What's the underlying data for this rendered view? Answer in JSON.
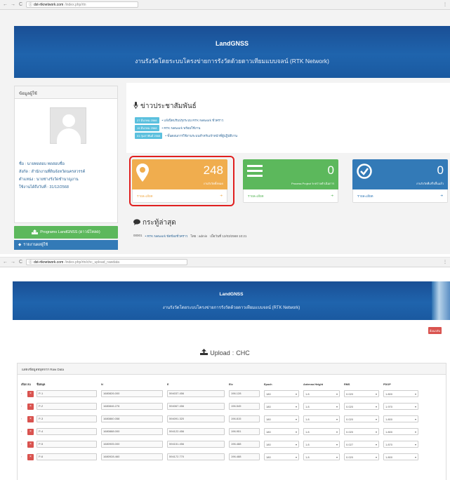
{
  "screen1": {
    "browser": {
      "back": "←",
      "forward": "→",
      "reload": "C",
      "info": "ⓘ",
      "host": "dst-rtknetwork.com",
      "path": "/index.php/rtn",
      "menu": "⋮"
    },
    "banner": {
      "brand": "LandGNSS",
      "subtitle": "งานรังวัดโดยระบบโครงข่ายการรังวัดด้วยดาวเทียมแบบจลน์ (RTK Network)"
    },
    "profile": {
      "header": "ข้อมูลผู้ใช้",
      "info": [
        "ชื่อ : นายทดสอบ ทดสอบชื่อ",
        "สังกัด : สำนักงานที่ดินจังหวัดนครสวรรค์",
        "ตำแหน่ง : นายช่างรังวัดชำนาญงาน",
        "ใช้งานได้ถึงวันที่ : 31/12/2568"
      ]
    },
    "program_button": "Programs LandGNSS (ดาวน์โหลด)",
    "menu_item": "รายงานผลผู้ใช้",
    "news": {
      "title": "ข่าวประชาสัมพันธ์",
      "items": [
        {
          "date": "27 มีนาคม 2568",
          "text": "• แจ้งปิดปรับปรุงระบบ RTK Network ชั่วคราว"
        },
        {
          "date": "15 มีนาคม 2568",
          "text": "• RTK Network พร้อมใช้งาน"
        },
        {
          "date": "01 กุมภาพันธ์ 2568",
          "text": "• ขั้นตอนการใช้งานระบบสำหรับเจ้าหน้าที่ผู้ปฏิบัติงาน"
        }
      ]
    },
    "cards": [
      {
        "value": "248",
        "caption": "งานรังวัดทั้งหมด",
        "footer": "รายละเอียด",
        "arrow": "➜"
      },
      {
        "value": "0",
        "caption": "Process Project ระหว่างดำเนินการ",
        "footer": "รายละเอียด",
        "arrow": "➜"
      },
      {
        "value": "0",
        "caption": "งานรังวัดที่เสร็จสิ้นแล้ว",
        "footer": "รายละเอียด",
        "arrow": "➜"
      }
    ],
    "announce": {
      "title": "กระทู้ล่าสุด",
      "id": "00001",
      "link": "• RTK Network ขัดข้องชั่วคราว",
      "by": "โดย : admin",
      "date": "เมื่อวันที่ 12/03/2568 10:21"
    }
  },
  "screen2": {
    "browser": {
      "back": "←",
      "forward": "→",
      "reload": "C",
      "info": "ⓘ",
      "host": "dst-rtknetwork.com",
      "path": "/index.php/rtn/chc_upload_rawdata",
      "menu": "⋮"
    },
    "banner": {
      "brand": "LandGNSS",
      "subtitle": "งานรังวัดโดยระบบโครงข่ายการรังวัดด้วยดาวเทียมแบบจลน์ (RTK Network)"
    },
    "back_button": "ย้อนกลับ",
    "upload_title": "Upload",
    "upload_vendor": "CHC",
    "panel_heading": "แสดงข้อมูลหมุดจาก Raw Data",
    "table": {
      "headers": [
        "เลือก",
        "ลบ",
        "ชื่อหมุด",
        "N",
        "E",
        "Elv",
        "Epoch",
        "Antenna Height",
        "RMS",
        "PDOP"
      ],
      "rows": [
        {
          "name": "P-1",
          "n": "1680826.000",
          "e": "594037.456",
          "elv": "196.128",
          "epoch": "180",
          "ant": "1.8",
          "rms": "0.020",
          "pdop": "1.800"
        },
        {
          "name": "P-2",
          "n": "1680846.276",
          "e": "594067.456",
          "elv": "196.545",
          "epoch": "180",
          "ant": "1.8",
          "rms": "0.020",
          "pdop": "1.970"
        },
        {
          "name": "P-3",
          "n": "1680860.058",
          "e": "594091.320",
          "elv": "196.815",
          "epoch": "180",
          "ant": "1.8",
          "rms": "0.020",
          "pdop": "1.800"
        },
        {
          "name": "P-4",
          "n": "1680888.000",
          "e": "594122.456",
          "elv": "196.951",
          "epoch": "180",
          "ant": "1.8",
          "rms": "0.020",
          "pdop": "1.800"
        },
        {
          "name": "P-5",
          "n": "1680905.000",
          "e": "594151.456",
          "elv": "196.488",
          "epoch": "180",
          "ant": "1.8",
          "rms": "0.027",
          "pdop": "1.870"
        },
        {
          "name": "P-6",
          "n": "1680928.460",
          "e": "594172.770",
          "elv": "196.488",
          "epoch": "180",
          "ant": "1.8",
          "rms": "0.020",
          "pdop": "1.800"
        }
      ]
    }
  }
}
